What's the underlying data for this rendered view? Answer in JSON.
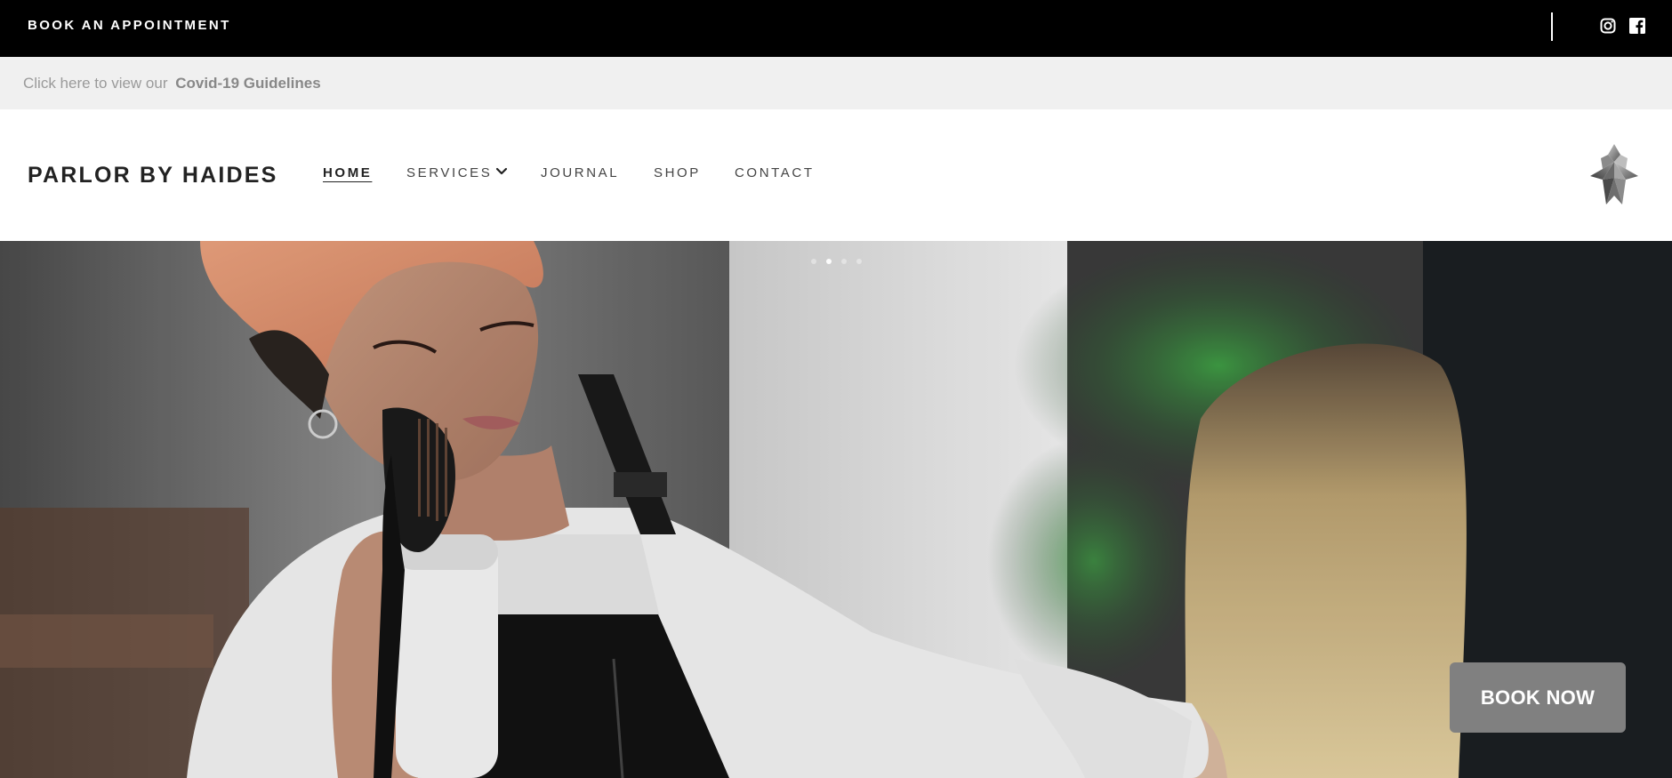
{
  "topbar": {
    "book_label": "BOOK AN APPOINTMENT",
    "social": [
      "instagram-icon",
      "facebook-icon"
    ]
  },
  "covid": {
    "prefix": "Click here to view our",
    "link": "Covid-19 Guidelines"
  },
  "brand": {
    "name": "PARLOR BY HAIDES"
  },
  "nav": {
    "items": [
      {
        "label": "HOME",
        "active": true
      },
      {
        "label": "SERVICES",
        "has_dropdown": true
      },
      {
        "label": "JOURNAL"
      },
      {
        "label": "SHOP"
      },
      {
        "label": "CONTACT"
      }
    ]
  },
  "hero": {
    "slides": 4,
    "active_slide": 2
  },
  "cta": {
    "book_now": "BOOK NOW"
  },
  "colors": {
    "topbar_bg": "#000000",
    "covid_bar_bg": "#f0f0f0",
    "cta_bg": "#808080"
  }
}
